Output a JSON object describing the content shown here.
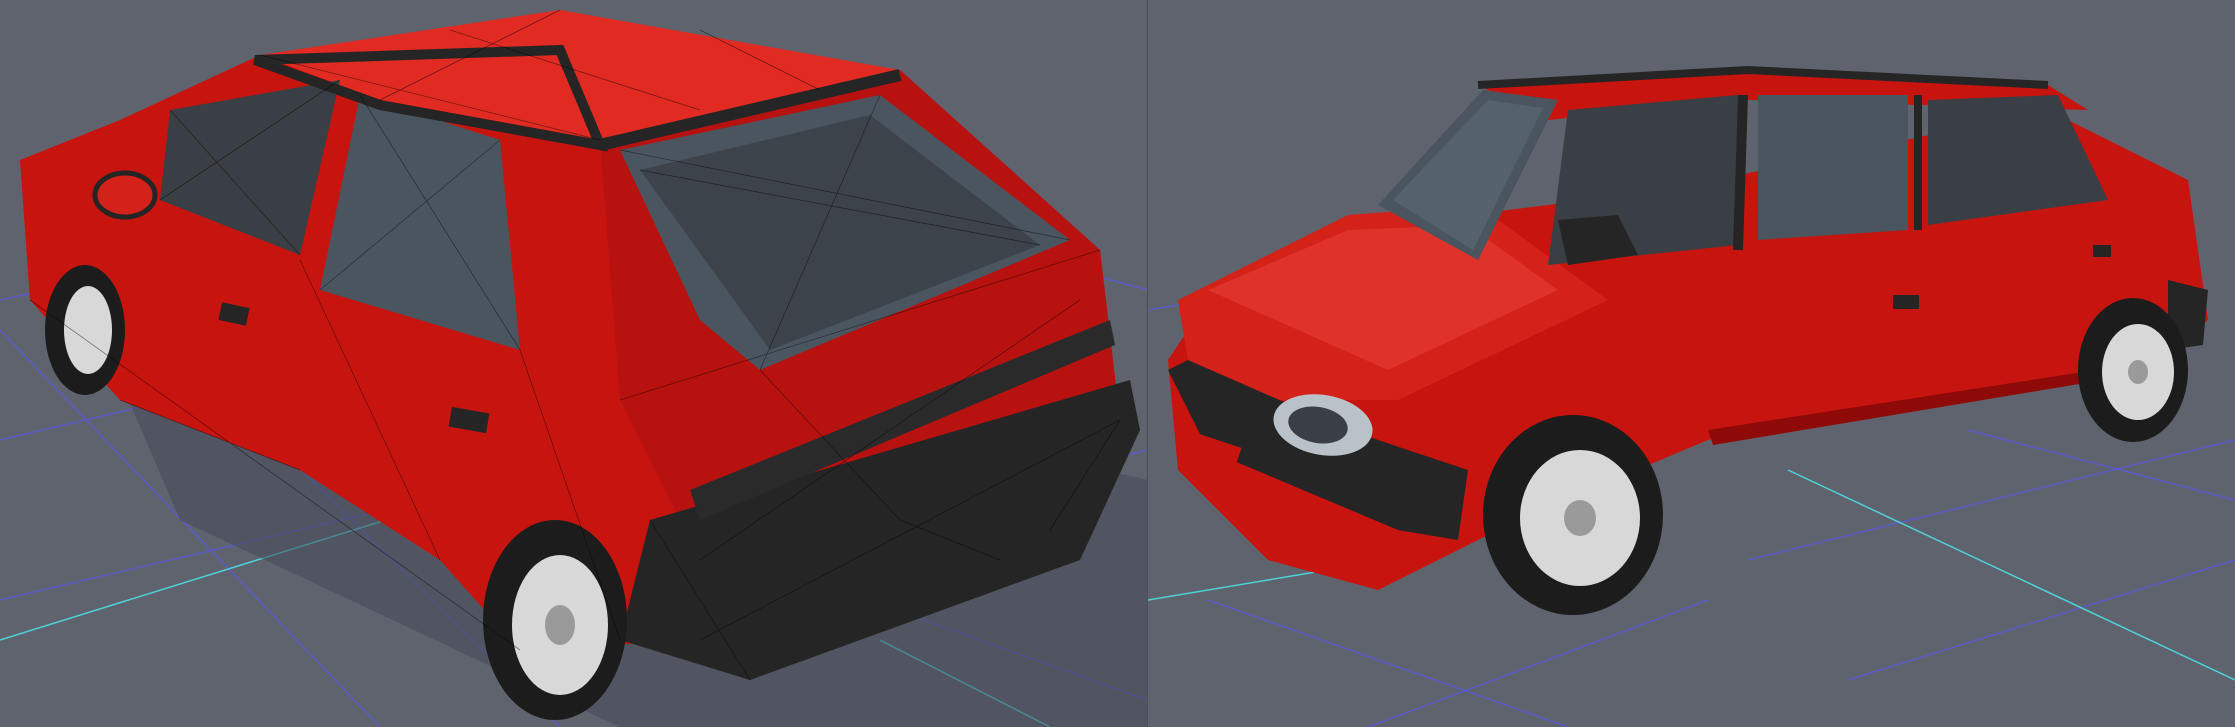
{
  "scene": {
    "viewports": [
      {
        "id": "left",
        "render_mode": "shaded-wireframe"
      },
      {
        "id": "right",
        "render_mode": "shaded"
      }
    ],
    "colors": {
      "background": "#5f636d",
      "grid_line": "#5a5ad8",
      "grid_axis": "#4fd2d8",
      "body_red": "#c8140e",
      "body_red_dark": "#8e0a08",
      "body_red_light": "#e8433c",
      "trim_black": "#252525",
      "glass": "#4a5560",
      "interior": "#3a3e45",
      "wheel_silver": "#d8d8d8",
      "tire": "#1c1c1c",
      "wire": "#000000"
    },
    "icons": [
      "wireframe-car-icon",
      "shaded-car-icon"
    ]
  }
}
